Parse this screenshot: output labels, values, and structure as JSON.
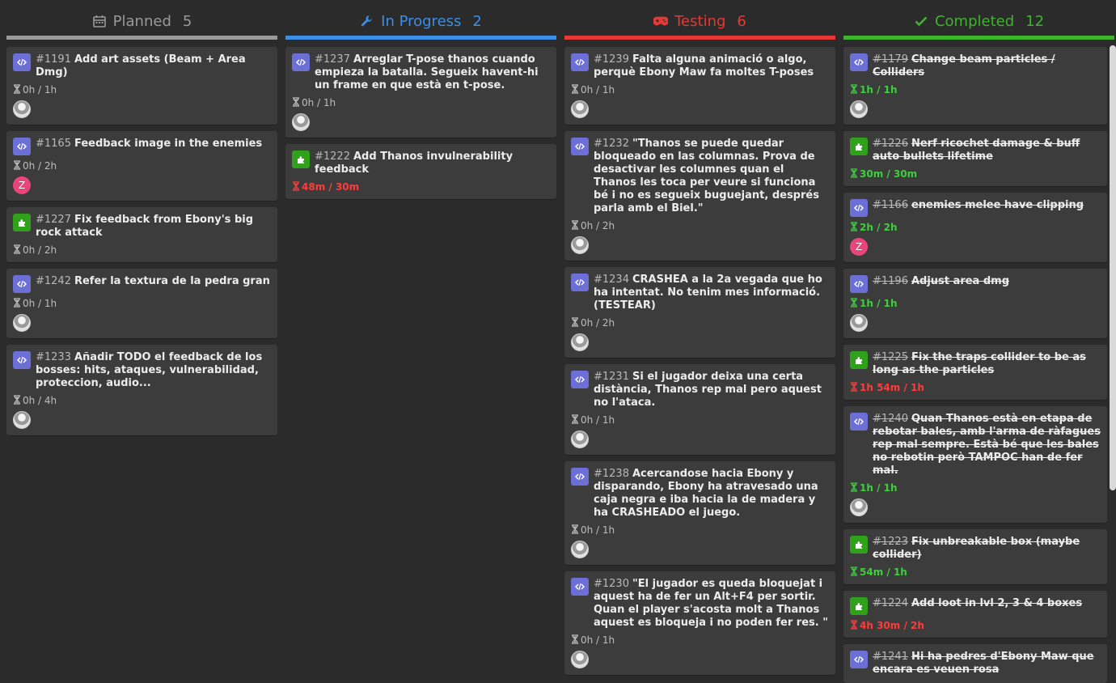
{
  "columns": [
    {
      "title": "Planned",
      "count": "5",
      "color": "#9a9a9a",
      "icon": "calendar-icon",
      "cards": [
        {
          "id": "#1191",
          "title": "Add art assets (Beam + Area Dmg)",
          "type": "code",
          "time": "0h / 1h",
          "time_style": "normal",
          "avatar": "photo"
        },
        {
          "id": "#1165",
          "title": "Feedback image in the enemies",
          "type": "code",
          "time": "0h / 2h",
          "time_style": "normal",
          "avatar": "letter",
          "avatar_letter": "Z"
        },
        {
          "id": "#1227",
          "title": "Fix feedback from Ebony's big rock attack",
          "type": "feature",
          "time": "0h / 2h",
          "time_style": "normal",
          "avatar": "none"
        },
        {
          "id": "#1242",
          "title": "Refer la textura de la pedra gran",
          "type": "code",
          "time": "0h / 1h",
          "time_style": "normal",
          "avatar": "photo"
        },
        {
          "id": "#1233",
          "title": "Añadir TODO el feedback de los bosses: hits, ataques, vulnerabilidad, proteccion, audio...",
          "type": "code",
          "time": "0h / 4h",
          "time_style": "normal",
          "avatar": "photo"
        }
      ]
    },
    {
      "title": "In Progress",
      "count": "2",
      "color": "#3b8fe6",
      "icon": "wrench-icon",
      "cards": [
        {
          "id": "#1237",
          "title": "Arreglar T-pose thanos cuando empieza la batalla. Segueix havent-hi un frame en que està en t-pose.",
          "type": "code",
          "time": "0h / 1h",
          "time_style": "normal",
          "avatar": "photo"
        },
        {
          "id": "#1222",
          "title": "Add Thanos invulnerability feedback",
          "type": "feature",
          "time": "48m / 30m",
          "time_style": "red",
          "avatar": "none"
        }
      ]
    },
    {
      "title": "Testing",
      "count": "6",
      "color": "#e53935",
      "icon": "gamepad-icon",
      "cards": [
        {
          "id": "#1239",
          "title": "Falta alguna animació o algo, perquè Ebony Maw fa moltes T-poses",
          "type": "code",
          "time": "0h / 1h",
          "time_style": "normal",
          "avatar": "photo"
        },
        {
          "id": "#1232",
          "title": "\"Thanos se puede quedar bloqueado en las columnas. Prova de desactivar les columnes quan el Thanos les toca per veure si funciona bé i no es segueix buguejant, després parla amb el Biel.\"",
          "type": "code",
          "time": "0h / 2h",
          "time_style": "normal",
          "avatar": "photo"
        },
        {
          "id": "#1234",
          "title": "CRASHEA a la 2a vegada que ho ha intentat. No tenim mes informació. (TESTEAR)",
          "type": "code",
          "time": "0h / 2h",
          "time_style": "normal",
          "avatar": "photo"
        },
        {
          "id": "#1231",
          "title": "Si el jugador deixa una certa distància, Thanos rep mal pero aquest no l'ataca.",
          "type": "code",
          "time": "0h / 1h",
          "time_style": "normal",
          "avatar": "photo"
        },
        {
          "id": "#1238",
          "title": "Acercandose hacia Ebony y disparando, Ebony ha atravesado una caja negra e iba hacia la de madera y ha CRASHEADO el juego.",
          "type": "code",
          "time": "0h / 1h",
          "time_style": "normal",
          "avatar": "photo"
        },
        {
          "id": "#1230",
          "title": "\"El jugador es queda bloquejat i aquest ha de fer un Alt+F4 per sortir. Quan el player s'acosta molt a Thanos aquest es bloqueja i no poden fer res. \"",
          "type": "code",
          "time": "0h / 1h",
          "time_style": "normal",
          "avatar": "photo"
        }
      ]
    },
    {
      "title": "Completed",
      "count": "12",
      "color": "#3cb52a",
      "icon": "check-icon",
      "cards": [
        {
          "id": "#1179",
          "title": "Change beam particles / Colliders",
          "type": "code",
          "time": "1h / 1h",
          "time_style": "green",
          "avatar": "photo"
        },
        {
          "id": "#1226",
          "title": "Nerf ricochet damage & buff auto bullets lifetime",
          "type": "feature",
          "time": "30m / 30m",
          "time_style": "green",
          "avatar": "none"
        },
        {
          "id": "#1166",
          "title": "enemies melee have clipping",
          "type": "code",
          "time": "2h / 2h",
          "time_style": "green",
          "avatar": "letter",
          "avatar_letter": "Z"
        },
        {
          "id": "#1196",
          "title": "Adjust area dmg",
          "type": "code",
          "time": "1h / 1h",
          "time_style": "green",
          "avatar": "photo"
        },
        {
          "id": "#1225",
          "title": "Fix the traps collider to be as long as the particles",
          "type": "feature",
          "time": "1h 54m / 1h",
          "time_style": "red",
          "avatar": "none"
        },
        {
          "id": "#1240",
          "title": "Quan Thanos està en etapa de rebotar bales, amb l'arma de ràfagues rep mal sempre. Està bé que les bales no rebotin però TAMPOC han de fer mal.",
          "type": "code",
          "time": "1h / 1h",
          "time_style": "green",
          "avatar": "photo"
        },
        {
          "id": "#1223",
          "title": "Fix unbreakable box (maybe collider)",
          "type": "feature",
          "time": "54m / 1h",
          "time_style": "green",
          "avatar": "none"
        },
        {
          "id": "#1224",
          "title": "Add loot in lvl 2, 3 & 4 boxes",
          "type": "feature",
          "time": "4h 30m / 2h",
          "time_style": "red",
          "avatar": "none"
        },
        {
          "id": "#1241",
          "title": "Hi ha pedres d'Ebony Maw que encara es veuen rosa",
          "type": "code",
          "time": "",
          "time_style": "normal",
          "avatar": "none"
        }
      ]
    }
  ]
}
